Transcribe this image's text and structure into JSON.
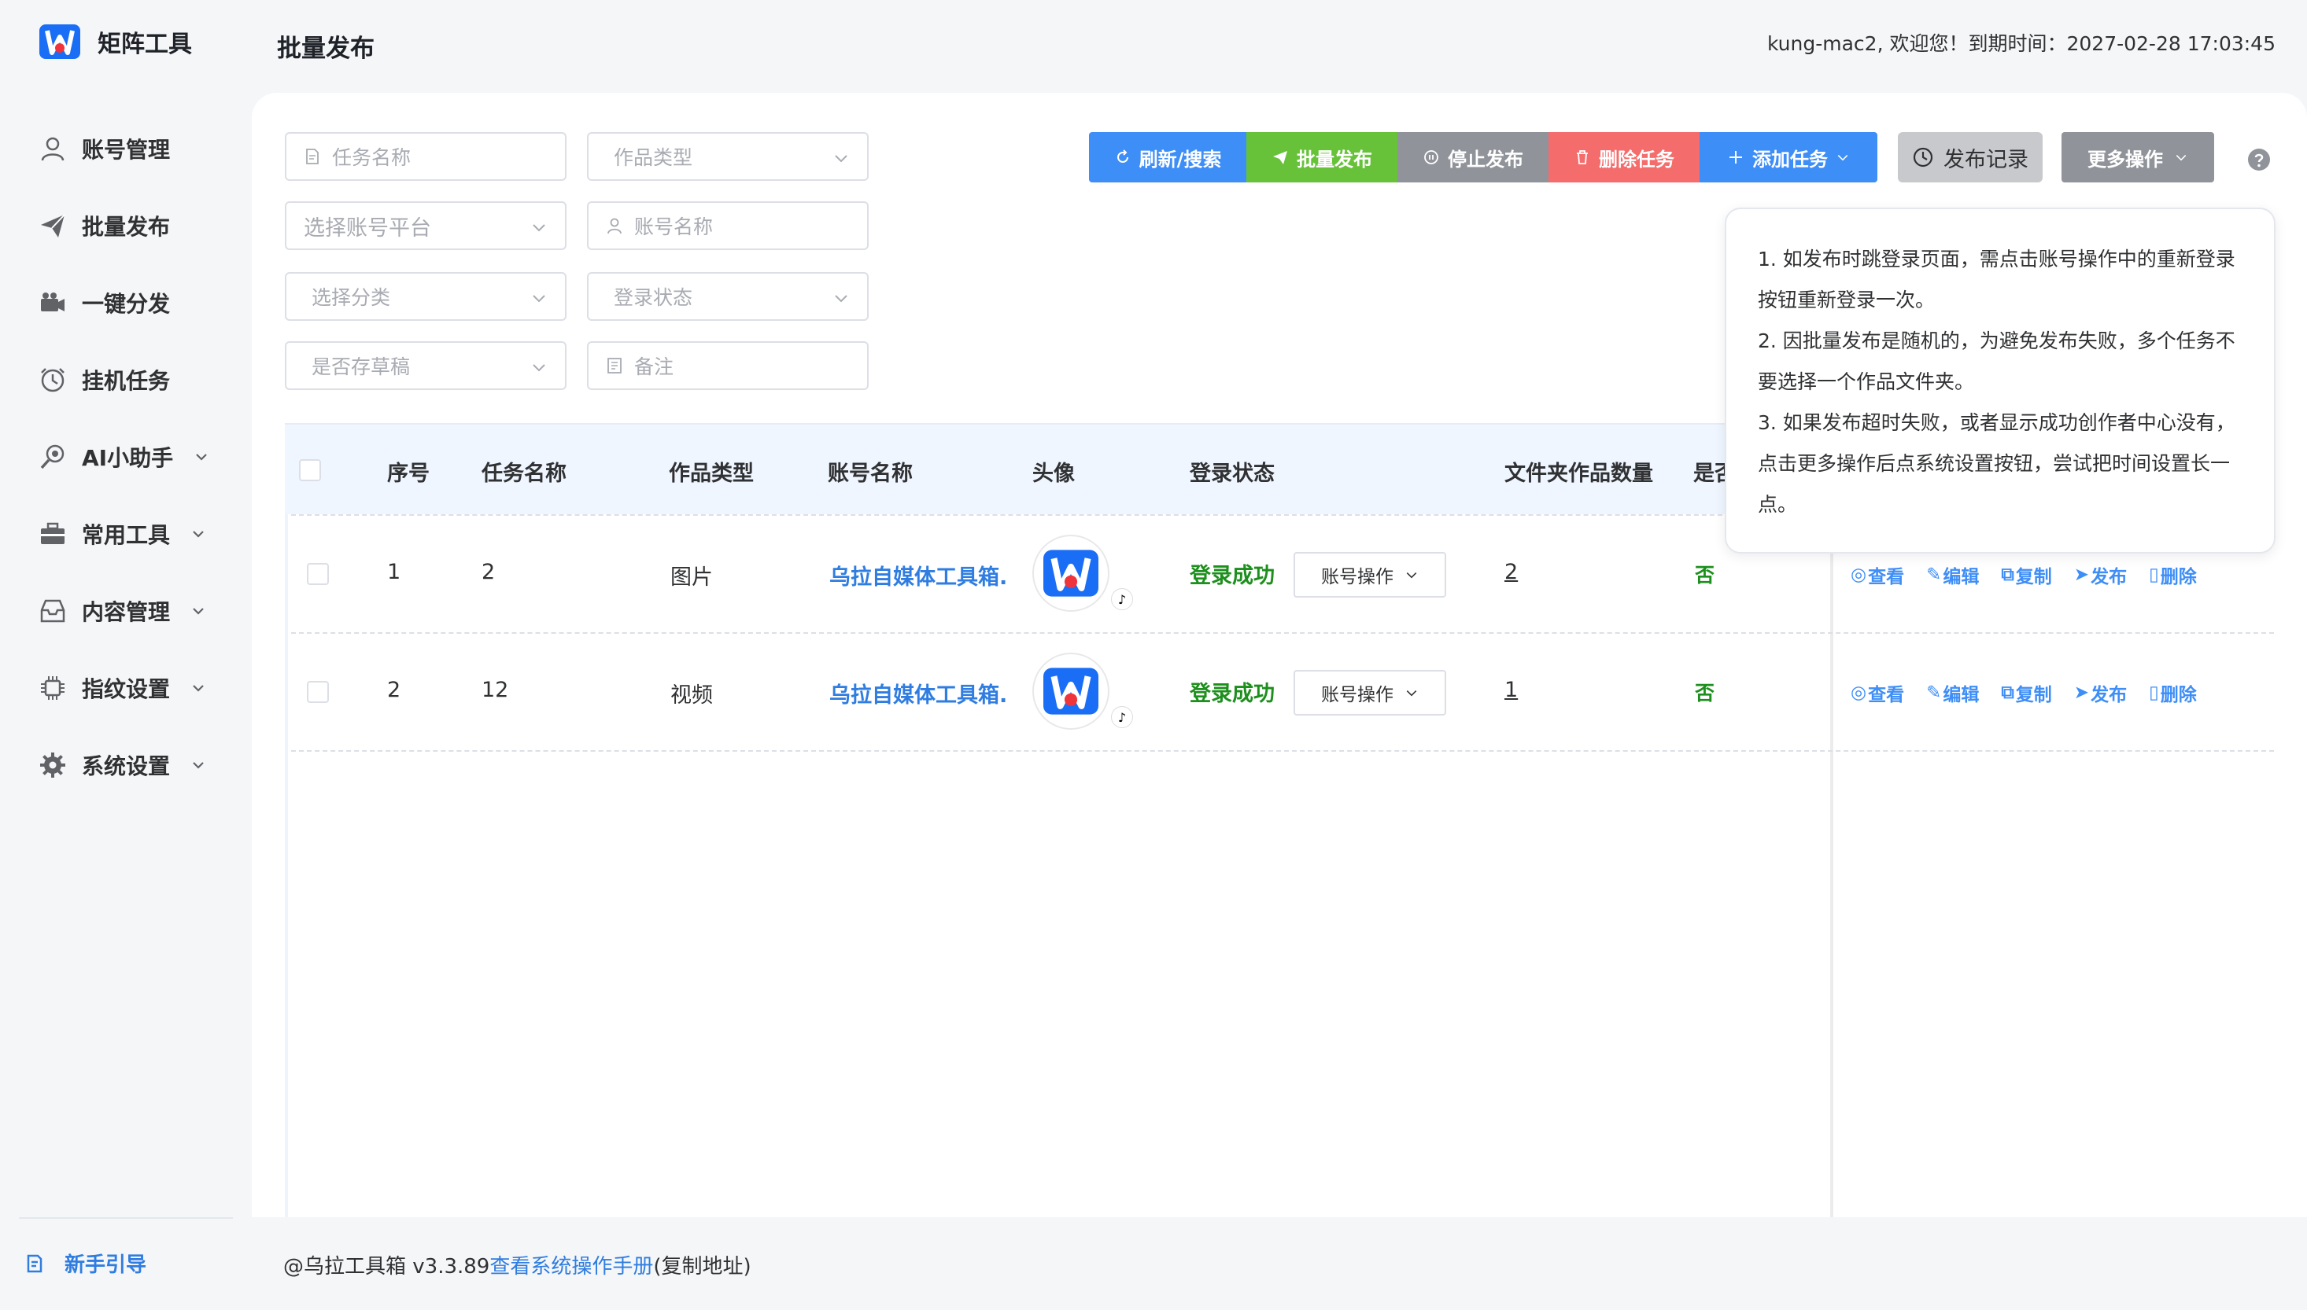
{
  "app": {
    "name": "矩阵工具"
  },
  "header": {
    "title": "批量发布",
    "welcome": "kung-mac2, 欢迎您！到期时间：2027-02-28 17:03:45"
  },
  "sidebar": {
    "items": [
      {
        "label": "账号管理",
        "icon": "user-icon"
      },
      {
        "label": "批量发布",
        "icon": "send-icon"
      },
      {
        "label": "一键分发",
        "icon": "camera-icon"
      },
      {
        "label": "挂机任务",
        "icon": "alarm-icon"
      },
      {
        "label": "AI小助手",
        "icon": "ai-icon",
        "expandable": true
      },
      {
        "label": "常用工具",
        "icon": "toolbox-icon",
        "expandable": true
      },
      {
        "label": "内容管理",
        "icon": "inbox-icon",
        "expandable": true
      },
      {
        "label": "指纹设置",
        "icon": "chip-icon",
        "expandable": true
      },
      {
        "label": "系统设置",
        "icon": "gear-icon",
        "expandable": true
      }
    ],
    "guide": "新手引导"
  },
  "filters": {
    "task_name": "任务名称",
    "work_type": "作品类型",
    "platform": "选择账号平台",
    "account_name": "账号名称",
    "category": "选择分类",
    "login_status": "登录状态",
    "draft": "是否存草稿",
    "remark": "备注"
  },
  "toolbar": {
    "refresh": "刷新/搜索",
    "batch_publish": "批量发布",
    "stop": "停止发布",
    "delete": "删除任务",
    "add": "添加任务",
    "records": "发布记录",
    "more": "更多操作"
  },
  "table": {
    "columns": [
      "序号",
      "任务名称",
      "作品类型",
      "账号名称",
      "头像",
      "登录状态",
      "文件夹作品数量",
      "是否"
    ],
    "rows": [
      {
        "index": "1",
        "task": "2",
        "type": "图片",
        "account": "乌拉自媒体工具箱.",
        "status": "登录成功",
        "op": "账号操作",
        "count": "2",
        "draft": "否"
      },
      {
        "index": "2",
        "task": "12",
        "type": "视频",
        "account": "乌拉自媒体工具箱.",
        "status": "登录成功",
        "op": "账号操作",
        "count": "1",
        "draft": "否"
      }
    ],
    "actions": [
      "查看",
      "编辑",
      "复制",
      "发布",
      "删除"
    ]
  },
  "tooltip": {
    "lines": [
      "1. 如发布时跳登录页面，需点击账号操作中的重新登录按钮重新登录一次。",
      "2. 因批量发布是随机的，为避免发布失败，多个任务不要选择一个作品文件夹。",
      "3. 如果发布超时失败，或者显示成功创作者中心没有，点击更多操作后点系统设置按钮，尝试把时间设置长一点。"
    ]
  },
  "footer": {
    "prefix": "@乌拉工具箱 v3.3.89",
    "link": "查看系统操作手册",
    "suffix": "(复制地址)"
  },
  "colors": {
    "primary": "#3e8ef7",
    "success": "#67c23a",
    "gray": "#909399",
    "danger": "#f56c6c",
    "link": "#2f7de1",
    "status_ok": "#1d8f1d"
  }
}
